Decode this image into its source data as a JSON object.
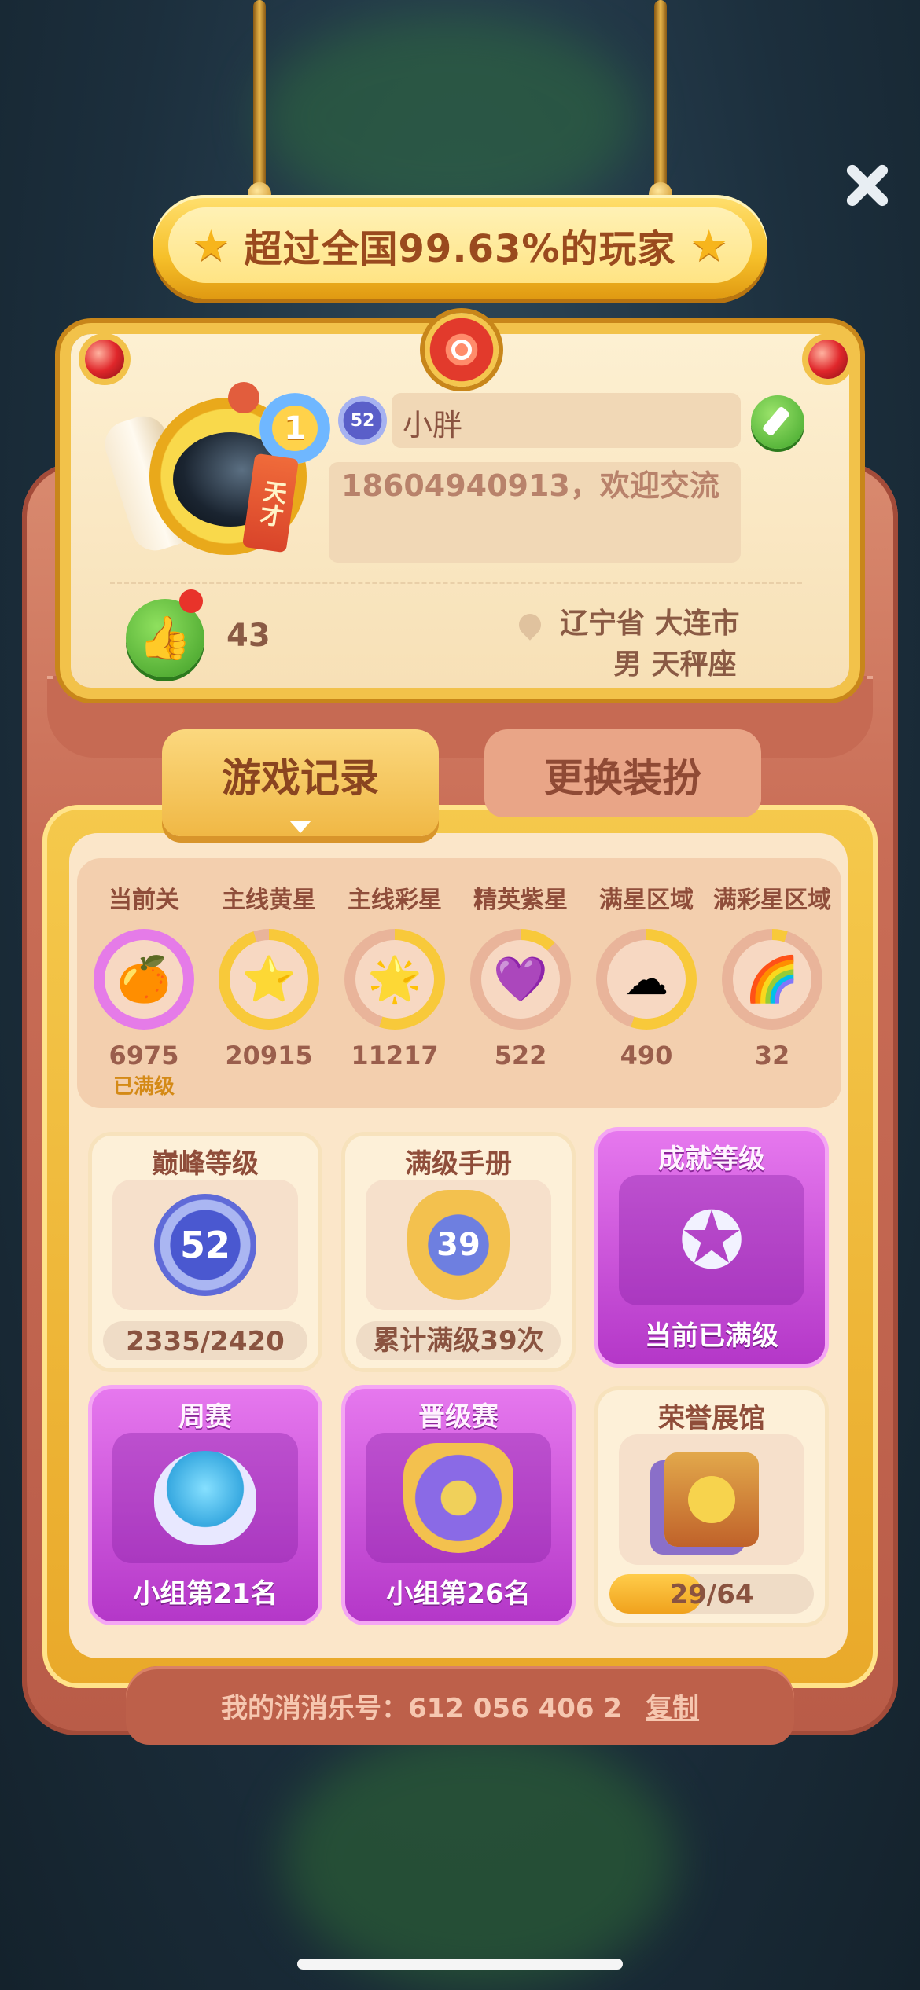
{
  "banner": {
    "text": "超过全国99.63%的玩家"
  },
  "profile": {
    "rank_number": "1",
    "rank_title": "天才",
    "level": "52",
    "name": "小胖",
    "signature": "18604940913，欢迎交流",
    "likes": "43",
    "location": "辽宁省  大连市",
    "gender_sign": "男  天秤座"
  },
  "tabs": [
    {
      "label": "游戏记录",
      "active": true
    },
    {
      "label": "更换装扮",
      "active": false
    }
  ],
  "stats": [
    {
      "label": "当前关",
      "value": "6975",
      "sub": "已满级",
      "icon": "orange-fruit-icon",
      "progress": 1.0
    },
    {
      "label": "主线黄星",
      "value": "20915",
      "sub": "",
      "icon": "yellow-star-icon",
      "progress": 0.95
    },
    {
      "label": "主线彩星",
      "value": "11217",
      "sub": "",
      "icon": "rainbow-star-icon",
      "progress": 0.55
    },
    {
      "label": "精英紫星",
      "value": "522",
      "sub": "",
      "icon": "purple-star-icon",
      "progress": 0.12
    },
    {
      "label": "满星区域",
      "value": "490",
      "sub": "",
      "icon": "cloud-icon",
      "progress": 0.55
    },
    {
      "label": "满彩星区域",
      "value": "32",
      "sub": "",
      "icon": "rainbow-cloud-icon",
      "progress": 0.05
    }
  ],
  "cards": {
    "peak": {
      "title": "巅峰等级",
      "badge": "52",
      "foot": "2335/2420"
    },
    "manual": {
      "title": "满级手册",
      "badge": "39",
      "foot": "累计满级39次"
    },
    "achievement": {
      "title": "成就等级",
      "foot": "当前已满级"
    },
    "weekly": {
      "title": "周赛",
      "foot": "小组第21名"
    },
    "promotion": {
      "title": "晋级赛",
      "foot": "小组第26名"
    },
    "honor": {
      "title": "荣誉展馆",
      "progress_text": "29/64",
      "progress": 0.453
    }
  },
  "footer": {
    "id_text": "我的消消乐号：612 056 406 2",
    "copy_label": "复制"
  },
  "colors": {
    "accent_gold": "#f6c02a",
    "purple_card": "#c24fd6",
    "ring_gold": "#f8c93a"
  }
}
